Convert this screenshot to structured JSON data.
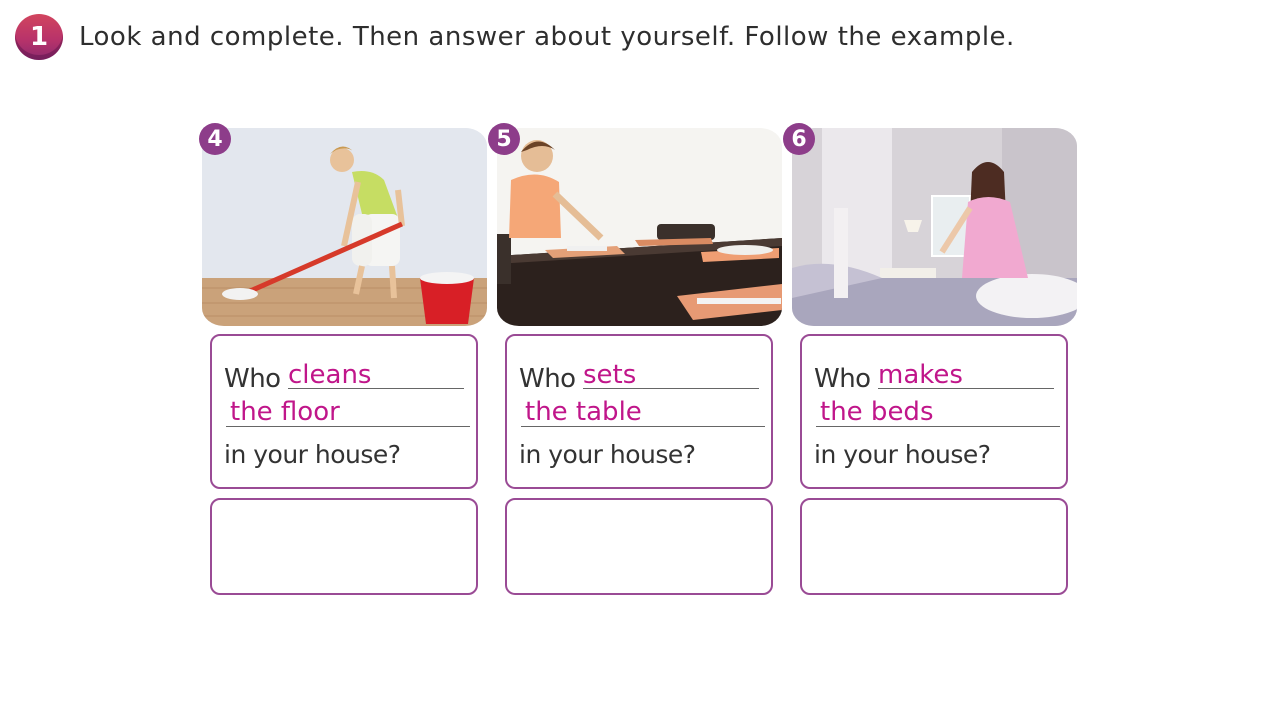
{
  "exercise": {
    "number": "1",
    "instruction": "Look and complete. Then answer about yourself. Follow the example."
  },
  "cards": [
    {
      "number": "4",
      "who": "Who",
      "answer_line1": "cleans",
      "answer_line2": "the floor",
      "question_end": "in your house?",
      "answer": ""
    },
    {
      "number": "5",
      "who": "Who",
      "answer_line1": "sets",
      "answer_line2": "the table",
      "question_end": "in your house?",
      "answer": ""
    },
    {
      "number": "6",
      "who": "Who",
      "answer_line1": "makes",
      "answer_line2": "the beds",
      "question_end": "in your house?",
      "answer": ""
    }
  ],
  "colors": {
    "accent_purple": "#9a4b95",
    "answer_magenta": "#c0168a",
    "badge_red": "#c83a64"
  }
}
